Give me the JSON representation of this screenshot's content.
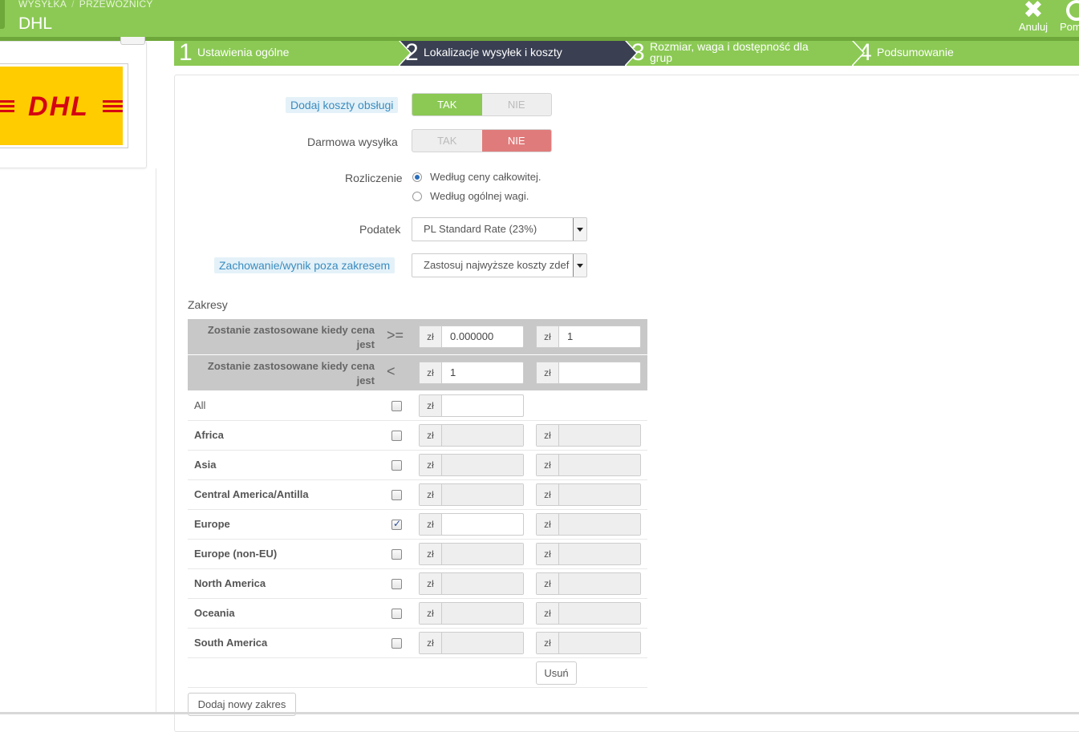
{
  "header": {
    "breadcrumb": [
      "WYSYŁKA",
      "PRZEWOŹNICY"
    ],
    "title": "DHL",
    "cancel_label": "Anuluj",
    "help_label": "Pomoc"
  },
  "steps": [
    {
      "num": "1",
      "label": "Ustawienia ogólne"
    },
    {
      "num": "2",
      "label": "Lokalizacje wysyłek i koszty"
    },
    {
      "num": "3",
      "label": "Rozmiar, waga i dostępność dla grup"
    },
    {
      "num": "4",
      "label": "Podsumowanie"
    }
  ],
  "logo": {
    "text": "DHL"
  },
  "form": {
    "handling_label": "Dodaj koszty obsługi",
    "free_label": "Darmowa wysyłka",
    "toggle_yes": "TAK",
    "toggle_no": "NIE",
    "billing_label": "Rozliczenie",
    "billing_price": "Według ceny całkowitej.",
    "billing_weight": "Według ogólnej wagi.",
    "tax_label": "Podatek",
    "tax_value": "PL Standard Rate (23%)",
    "oor_label": "Zachowanie/wynik poza zakresem",
    "oor_value": "Zastosuj najwyższe koszty zdef"
  },
  "ranges": {
    "title": "Zakresy",
    "head_text": "Zostanie zastosowane kiedy cena jest",
    "op_ge": ">=",
    "op_lt": "<",
    "currency": "zł",
    "ge_1": "0.000000",
    "ge_2": "1",
    "lt_1": "1",
    "lt_2": "",
    "zones": [
      "All",
      "Africa",
      "Asia",
      "Central America/Antilla",
      "Europe",
      "Europe (non-EU)",
      "North America",
      "Oceania",
      "South America"
    ],
    "delete_label": "Usuń",
    "add_label": "Dodaj nowy zakres"
  },
  "colors": {
    "brand_green": "#8bc954",
    "active_step": "#3a4052",
    "toggle_red": "#e07b7b",
    "dhl_yellow": "#ffcc00",
    "dhl_red": "#d40511"
  }
}
